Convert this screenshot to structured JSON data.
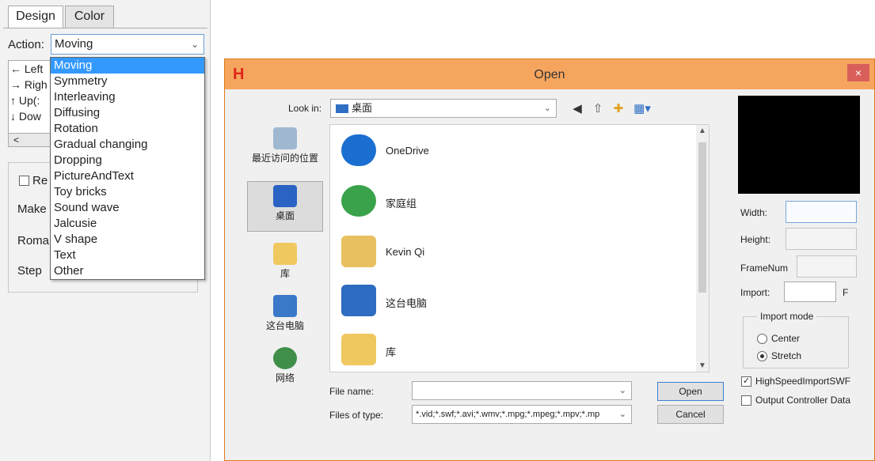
{
  "left_panel": {
    "tabs": [
      "Design",
      "Color"
    ],
    "action_label": "Action:",
    "action_value": "Moving",
    "direction_items": [
      "← Left",
      "→ Righ",
      "↑ Up(:",
      "↓ Dow"
    ],
    "scroll_left": "<",
    "labels": {
      "re": "Re",
      "make": "Make",
      "roma": "Roma",
      "step": "Step"
    },
    "dropdown_items": [
      "Moving",
      "Symmetry",
      "Interleaving",
      "Diffusing",
      "Rotation",
      "Gradual changing",
      "Dropping",
      "PictureAndText",
      "Toy bricks",
      "Sound wave",
      "Jalcusie",
      "V shape",
      "Text",
      "Other"
    ],
    "dropdown_selected_index": 0
  },
  "dialog": {
    "logo": "H",
    "title": "Open",
    "close": "×",
    "look_in_label": "Look in:",
    "look_in_value": "桌面",
    "places": [
      "最近访问的位置",
      "桌面",
      "库",
      "这台电脑",
      "网络"
    ],
    "files": [
      "OneDrive",
      "家庭组",
      "Kevin Qi",
      "这台电脑",
      "库"
    ],
    "file_name_label": "File name:",
    "file_name_value": "",
    "files_of_type_label": "Files of type:",
    "files_of_type_value": "*.vid;*.swf;*.avi;*.wmv;*.mpg;*.mpeg;*.mpv;*.mp",
    "open_button": "Open",
    "cancel_button": "Cancel",
    "right": {
      "width_label": "Width:",
      "height_label": "Height:",
      "framenum_label": "FrameNum",
      "import_label": "Import:",
      "import_unit": "F",
      "import_mode_title": "Import mode",
      "center_label": "Center",
      "stretch_label": "Stretch",
      "highspeed_label": "HighSpeedImportSWF",
      "output_label": "Output Controller Data",
      "highspeed_checked": true,
      "output_checked": false,
      "stretch_selected": true
    }
  },
  "colors": {
    "titlebar": "#f6a55e",
    "dialog_border": "#e07b1a",
    "close_button": "#d9605a",
    "selection": "#3399ff",
    "preview": "#000000"
  }
}
